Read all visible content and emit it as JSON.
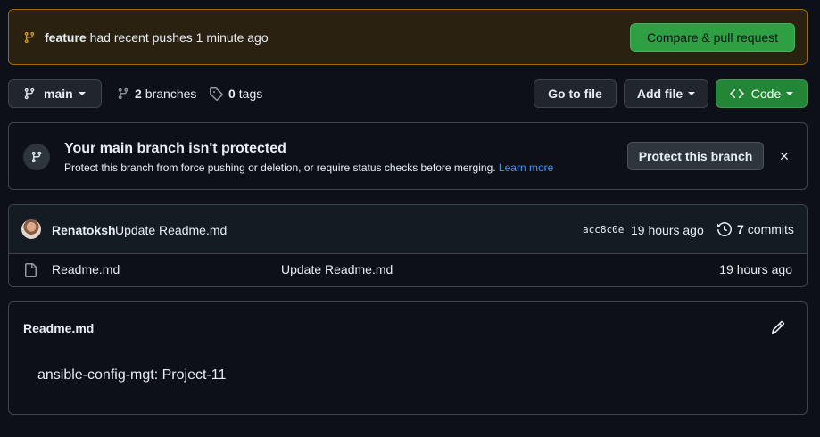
{
  "push_banner": {
    "branch": "feature",
    "message": "had recent pushes 1 minute ago",
    "compare_label": "Compare & pull request"
  },
  "toolbar": {
    "branch_selector": "main",
    "branches_count": "2",
    "branches_label": "branches",
    "tags_count": "0",
    "tags_label": "tags",
    "goto_file": "Go to file",
    "add_file": "Add file",
    "code": "Code"
  },
  "protect": {
    "title": "Your main branch isn't protected",
    "description": "Protect this branch from force pushing or deletion, or require status checks before merging.",
    "learn_more": "Learn more",
    "button": "Protect this branch"
  },
  "latest_commit": {
    "author": "Renatoksh",
    "message": "Update Readme.md",
    "sha": "acc8c0e",
    "time": "19 hours ago",
    "commits_count": "7",
    "commits_label": "commits"
  },
  "files": [
    {
      "name": "Readme.md",
      "last_commit": "Update Readme.md",
      "time": "19 hours ago"
    }
  ],
  "readme": {
    "title": "Readme.md",
    "content": "ansible-config-mgt: Project-11"
  },
  "icons": {
    "branch": "git-branch-icon",
    "tag": "tag-icon",
    "code": "code-icon",
    "history": "history-icon",
    "file": "file-icon",
    "close": "close-icon",
    "pencil": "pencil-icon"
  },
  "colors": {
    "background": "#0d1117",
    "banner_bg": "#2b2111",
    "banner_border": "#9e6a03",
    "accent_green": "#2ea043",
    "link_blue": "#4493f8"
  }
}
